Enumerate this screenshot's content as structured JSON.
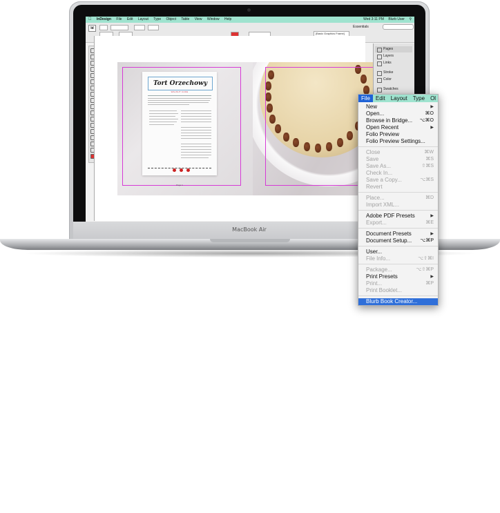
{
  "laptop": {
    "label": "MacBook Air"
  },
  "menubar": {
    "apple": "",
    "app": "InDesign",
    "items": [
      "File",
      "Edit",
      "Layout",
      "Type",
      "Object",
      "Table",
      "View",
      "Window",
      "Help"
    ],
    "status": {
      "time": "Wed 3:11 PM",
      "user": "Blurb User"
    }
  },
  "control": {
    "logo": "Id",
    "workspace": "Essentials",
    "search_placeholder": "",
    "frame_style": "[Basic Graphics Frame]"
  },
  "document": {
    "title": "Tort Orzechowy",
    "subtitle": "WALNUT CAKE",
    "footer": "Page 1"
  },
  "panels": {
    "items": [
      "Pages",
      "Layers",
      "Links",
      "Stroke",
      "Color",
      "Swatches"
    ]
  },
  "file_menu": {
    "bar": [
      "File",
      "Edit",
      "Layout",
      "Type",
      "Ol"
    ],
    "items": [
      {
        "label": "New",
        "shortcut": "",
        "arrow": true,
        "disabled": false
      },
      {
        "label": "Open...",
        "shortcut": "⌘O",
        "arrow": false,
        "disabled": false
      },
      {
        "label": "Browse in Bridge...",
        "shortcut": "⌥⌘O",
        "arrow": false,
        "disabled": false
      },
      {
        "label": "Open Recent",
        "shortcut": "",
        "arrow": true,
        "disabled": false
      },
      {
        "label": "Folio Preview",
        "shortcut": "",
        "arrow": false,
        "disabled": false
      },
      {
        "label": "Folio Preview Settings...",
        "shortcut": "",
        "arrow": false,
        "disabled": false
      },
      {
        "label": "Close",
        "shortcut": "⌘W",
        "arrow": false,
        "disabled": true
      },
      {
        "label": "Save",
        "shortcut": "⌘S",
        "arrow": false,
        "disabled": true
      },
      {
        "label": "Save As...",
        "shortcut": "⇧⌘S",
        "arrow": false,
        "disabled": true
      },
      {
        "label": "Check In...",
        "shortcut": "",
        "arrow": false,
        "disabled": true
      },
      {
        "label": "Save a Copy...",
        "shortcut": "⌥⌘S",
        "arrow": false,
        "disabled": true
      },
      {
        "label": "Revert",
        "shortcut": "",
        "arrow": false,
        "disabled": true
      },
      {
        "label": "Place...",
        "shortcut": "⌘D",
        "arrow": false,
        "disabled": true
      },
      {
        "label": "Import XML...",
        "shortcut": "",
        "arrow": false,
        "disabled": true
      },
      {
        "label": "Adobe PDF Presets",
        "shortcut": "",
        "arrow": true,
        "disabled": false
      },
      {
        "label": "Export...",
        "shortcut": "⌘E",
        "arrow": false,
        "disabled": true
      },
      {
        "label": "Document Presets",
        "shortcut": "",
        "arrow": true,
        "disabled": false
      },
      {
        "label": "Document Setup...",
        "shortcut": "⌥⌘P",
        "arrow": false,
        "disabled": false
      },
      {
        "label": "User...",
        "shortcut": "",
        "arrow": false,
        "disabled": false
      },
      {
        "label": "File Info...",
        "shortcut": "⌥⇧⌘I",
        "arrow": false,
        "disabled": true
      },
      {
        "label": "Package...",
        "shortcut": "⌥⇧⌘P",
        "arrow": false,
        "disabled": true
      },
      {
        "label": "Print Presets",
        "shortcut": "",
        "arrow": true,
        "disabled": false
      },
      {
        "label": "Print...",
        "shortcut": "⌘P",
        "arrow": false,
        "disabled": true
      },
      {
        "label": "Print Booklet...",
        "shortcut": "",
        "arrow": false,
        "disabled": true
      },
      {
        "label": "Blurb Book Creator...",
        "shortcut": "",
        "arrow": false,
        "disabled": false,
        "highlighted": true
      }
    ]
  }
}
